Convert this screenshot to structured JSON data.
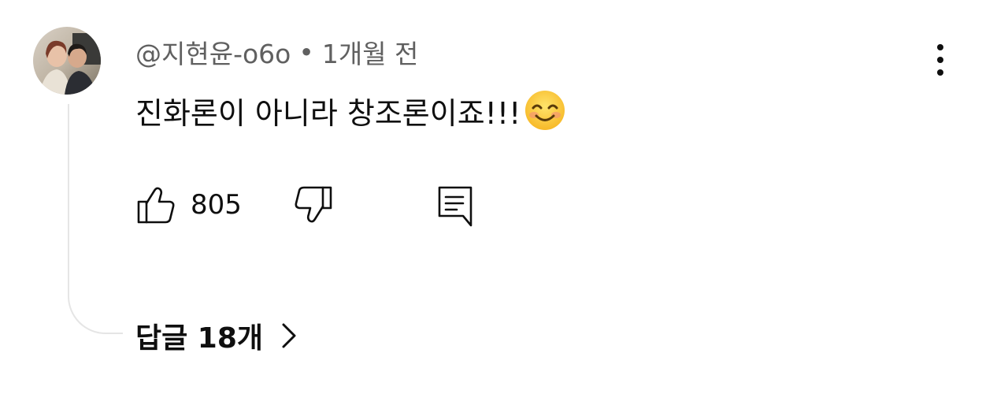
{
  "comment": {
    "author": "@지현윤-o6o",
    "separator": "•",
    "timestamp": "1개월 전",
    "text": "진화론이 아니라 창조론이죠!!!",
    "emoji": "smiling-face-with-smiling-eyes",
    "like_count": "805",
    "replies_label": "답글 18개"
  },
  "icons": {
    "more": "more-vertical-icon",
    "like": "thumbs-up-icon",
    "dislike": "thumbs-down-icon",
    "reply": "reply-comment-icon",
    "chevron": "chevron-right-icon"
  },
  "colors": {
    "text_primary": "#0f0f0f",
    "text_secondary": "#606060",
    "thread_line": "#e5e5e5",
    "background": "#ffffff"
  }
}
